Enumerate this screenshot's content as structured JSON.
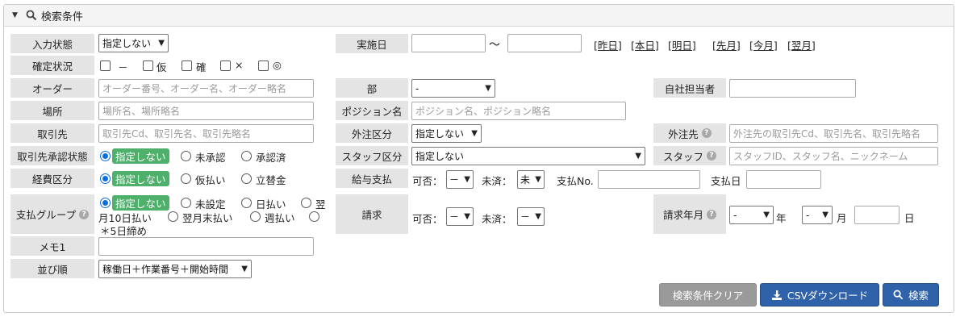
{
  "header": {
    "title": "検索条件"
  },
  "labels": {
    "input_status": "入力状態",
    "confirm_status": "確定状況",
    "order": "オーダー",
    "place": "場所",
    "client": "取引先",
    "client_approval": "取引先承認状態",
    "expense_type": "経費区分",
    "payment_group": "支払グループ",
    "memo": "メモ1",
    "sort": "並び順",
    "date": "実施日",
    "dept": "部",
    "position": "ポジション名",
    "outsource_type": "外注区分",
    "staff_type": "スタッフ区分",
    "salary_payment": "給与支払",
    "billing": "請求",
    "in_house": "自社担当者",
    "outsource_to": "外注先",
    "staff": "スタッフ",
    "billing_ym": "請求年月"
  },
  "input_status_select": "指定しない",
  "confirm_checkboxes": [
    "－",
    "仮",
    "確",
    "×",
    "◎"
  ],
  "placeholders": {
    "order": "オーダー番号、オーダー名、オーダー略名",
    "place": "場所名、場所略名",
    "client": "取引先Cd、取引先名、取引先略名",
    "position": "ポジション名、ポジション略名",
    "outsource_to": "外注先の取引先Cd、取引先名、取引先略名",
    "staff": "スタッフID、スタッフ名、ニックネーム"
  },
  "date_range": {
    "tilde": "～",
    "links": [
      "[昨日]",
      "[本日]",
      "[明日]",
      "[先月]",
      "[今月]",
      "[翌月]"
    ]
  },
  "dept_select": "-",
  "outsource_type_select": "指定しない",
  "staff_type_select": "指定しない",
  "client_approval_options": [
    "指定しない",
    "未承認",
    "承認済"
  ],
  "expense_options": [
    "指定しない",
    "仮払い",
    "立替金"
  ],
  "payment_group": {
    "options": [
      "指定しない",
      "未設定",
      "日払い"
    ],
    "line2": [
      "月10日払い",
      "翌月末払い",
      "週払い"
    ],
    "tail": "翌",
    "line3": "＊5日締め"
  },
  "salary": {
    "possible_label": "可否：",
    "possible_value": "－",
    "unsettled_label": "未済：",
    "unsettled_value": "未",
    "payment_no_label": "支払No.",
    "payment_date_label": "支払日"
  },
  "billing": {
    "possible_label": "可否：",
    "possible_value": "－",
    "unsettled_label": "未済：",
    "unsettled_value": "－"
  },
  "billing_ym": {
    "year_value": "-",
    "year_unit": "年",
    "month_value": "-",
    "month_unit": "月",
    "day_unit": "日"
  },
  "sort_select": "稼働日＋作業番号＋開始時間",
  "help_glyph": "?",
  "buttons": {
    "clear": "検索条件クリア",
    "csv": "CSVダウンロード",
    "search": "検索"
  },
  "colors": {
    "label_bg": "#e4e4e4",
    "selected_pill": "#4fb06b",
    "primary_button": "#2f62a8",
    "clear_button": "#9a9a9a",
    "radio_selected": "#0a6ede"
  }
}
